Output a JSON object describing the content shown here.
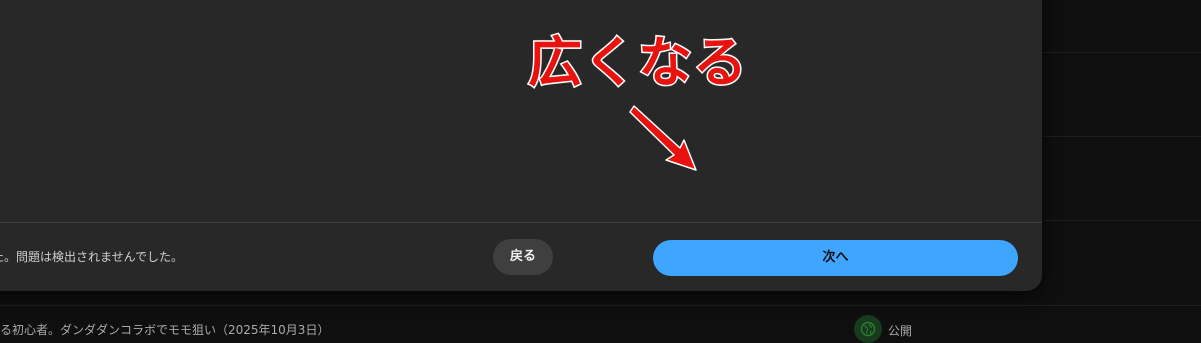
{
  "dialog": {
    "status_text": "た。問題は検出されませんでした。",
    "back_label": "戻る",
    "next_label": "次へ"
  },
  "video_row": {
    "title": "る初心者。ダンダダンコラボでモモ狙い（2025年10月3日）",
    "visibility_label": "公開",
    "visibility_icon": "globe-icon",
    "visibility_color": "#2e7d32"
  },
  "annotation": {
    "text": "広くなる",
    "color": "#e8120f",
    "arrow_icon": "arrow-down-right-icon"
  },
  "colors": {
    "dialog_bg": "#282828",
    "page_bg": "#0f0f0f",
    "primary_button": "#3ea6ff",
    "secondary_button": "#3f3f3f"
  }
}
